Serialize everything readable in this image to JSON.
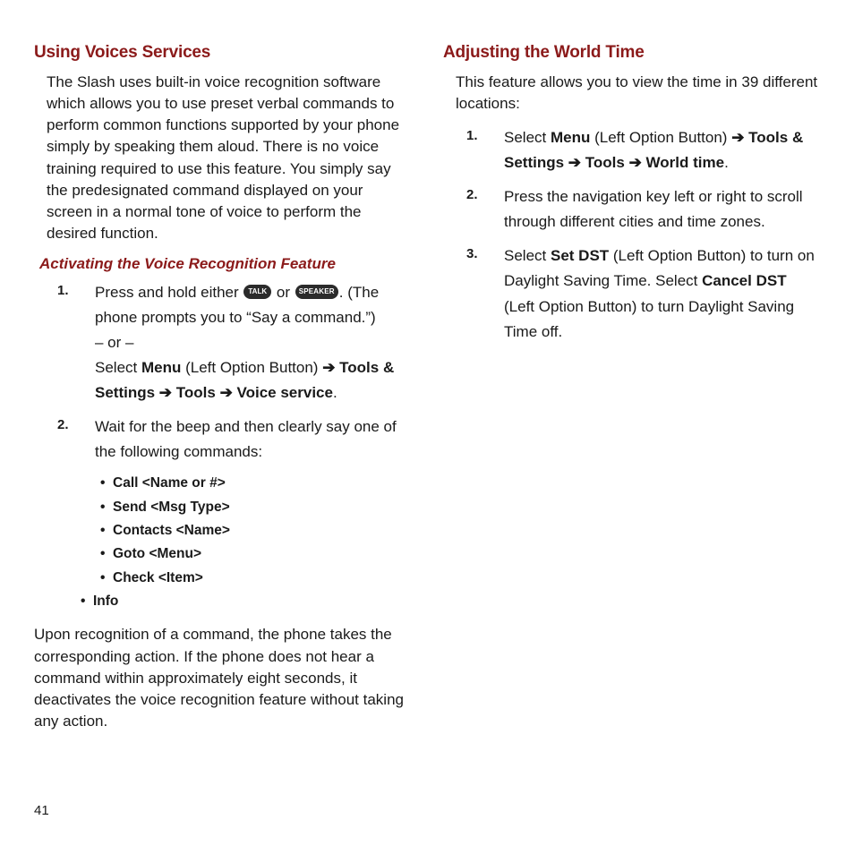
{
  "page_number": "41",
  "left": {
    "heading": "Using Voices Services",
    "intro": "The Slash uses built-in voice recognition software which allows you to use preset verbal commands to perform common functions supported by your phone simply by speaking them aloud. There is no voice training required to use this feature. You simply say the predesignated command displayed on your screen in a normal tone of voice to perform the desired function.",
    "sub_heading": "Activating the Voice Recognition Feature",
    "step1_pre": "Press and hold either ",
    "step1_key1": "TALK",
    "step1_between": " or ",
    "step1_key2": "SPEAKER",
    "step1_post_a": ". (The phone prompts you to “Say a command.”)",
    "step1_or": "– or –",
    "step1_alt_pre": "Select ",
    "step1_menu": "Menu",
    "step1_alt_mid": " (Left Option Button) ",
    "arrow1": "➔",
    "step1_tools_settings": " Tools & Settings ",
    "arrow2": "➔",
    "step1_tools": " Tools ",
    "arrow3": "➔",
    "step1_voice": " Voice service",
    "step2": "Wait for the beep and then clearly say one of the following commands:",
    "commands": [
      "Call <Name or #>",
      "Send <Msg Type>",
      "Contacts <Name>",
      "Goto <Menu>",
      "Check <Item>",
      "Info"
    ],
    "followup": "Upon recognition of a command, the phone takes the corresponding action. If the phone does not hear a command within approximately eight seconds, it deactivates the voice recognition feature without taking any action."
  },
  "right": {
    "heading": "Adjusting the World Time",
    "intro": "This feature allows you to view the time in 39 different locations:",
    "step1_pre": "Select ",
    "step1_menu": "Menu",
    "step1_mid": " (Left Option Button) ",
    "r_arrow1": "➔",
    "step1_ts": " Tools & Settings ",
    "r_arrow2": "➔",
    "step1_tools": " Tools ",
    "r_arrow3": "➔",
    "step1_world": " World time",
    "step2": "Press the navigation key left or right to scroll through different cities and time zones.",
    "step3_pre": "Select ",
    "step3_set": "Set DST",
    "step3_mid": " (Left Option Button) to turn on Daylight Saving Time. Select ",
    "step3_cancel": "Cancel DST",
    "step3_end": " (Left Option Button) to turn Daylight Saving Time off."
  }
}
